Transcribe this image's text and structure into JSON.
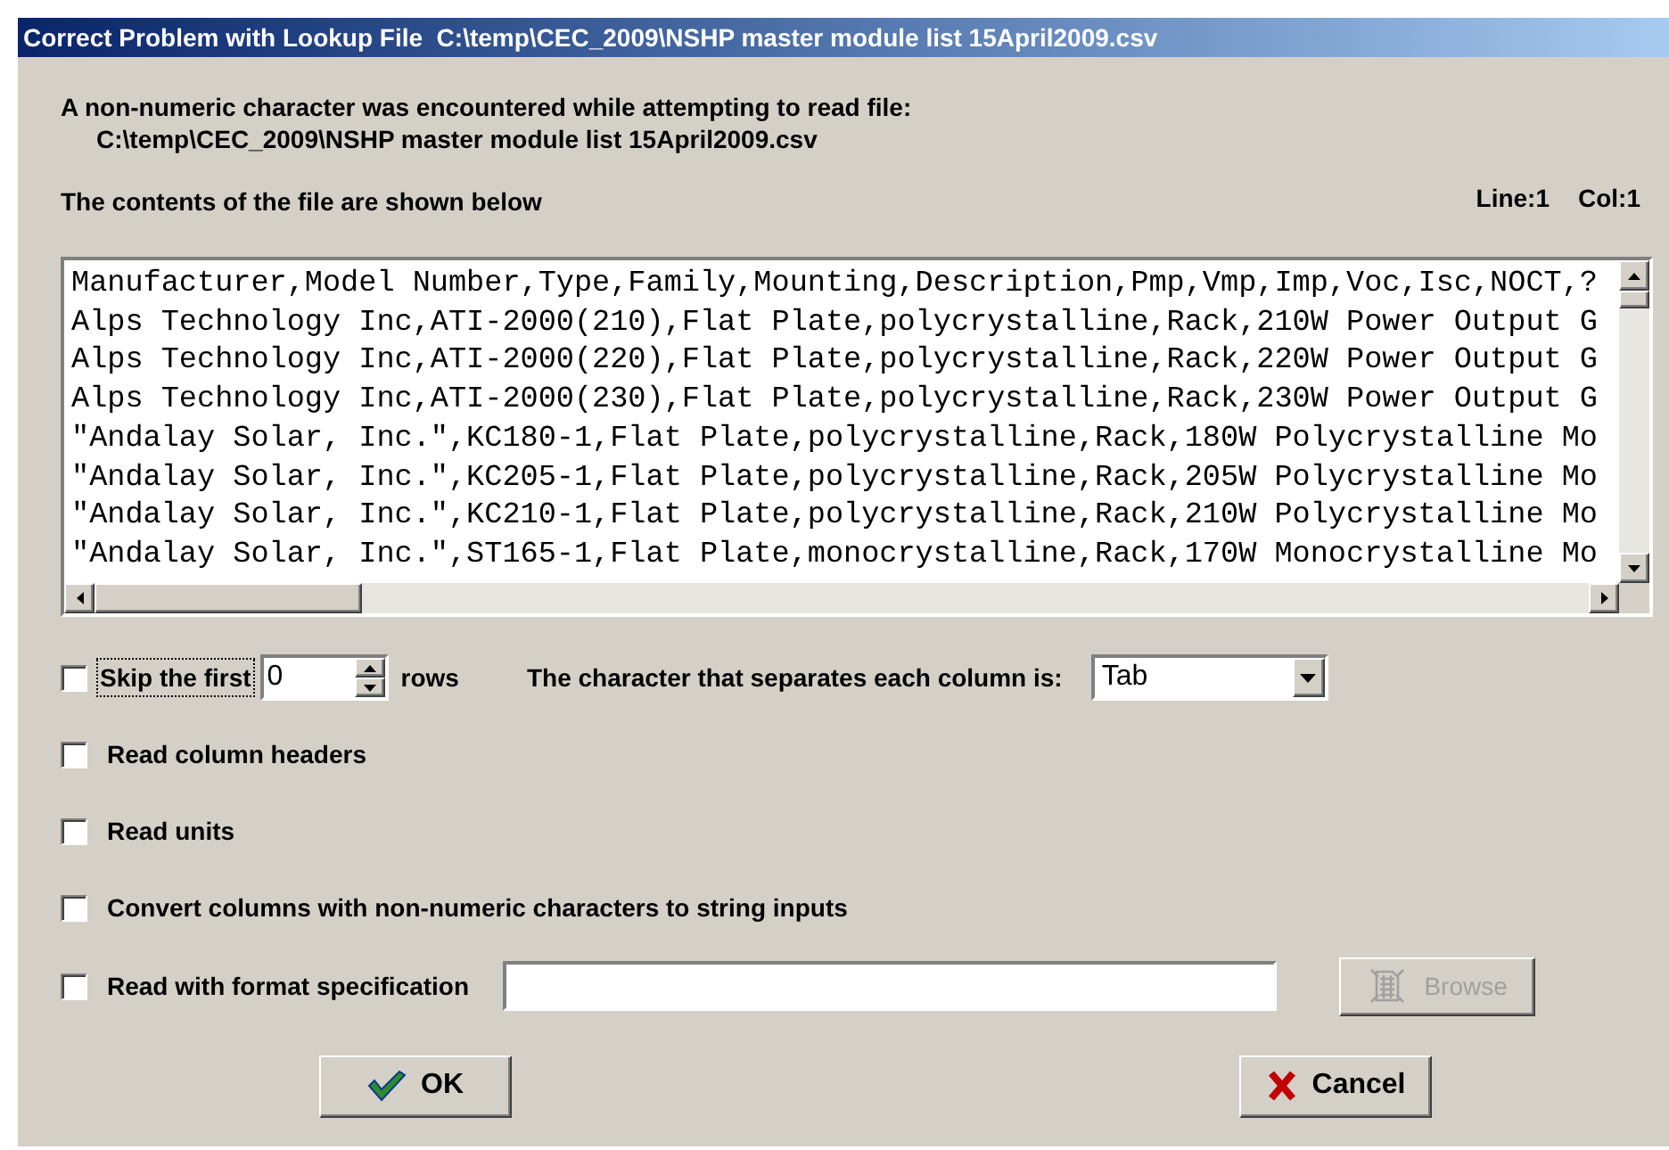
{
  "window": {
    "title": "Correct Problem with Lookup File  C:\\temp\\CEC_2009\\NSHP master module list 15April2009.csv"
  },
  "message": "A non-numeric character was encountered while attempting to read file:",
  "file_path": "C:\\temp\\CEC_2009\\NSHP master module list 15April2009.csv",
  "contents_label": "The contents of the file are shown below",
  "position": {
    "line": "Line:1",
    "col": "Col:1"
  },
  "file_lines": [
    "Manufacturer,Model Number,Type,Family,Mounting,Description,Pmp,Vmp,Imp,Voc,Isc,NOCT,?",
    "Alps Technology Inc,ATI-2000(210),Flat Plate,polycrystalline,Rack,210W Power Output G",
    "Alps Technology Inc,ATI-2000(220),Flat Plate,polycrystalline,Rack,220W Power Output G",
    "Alps Technology Inc,ATI-2000(230),Flat Plate,polycrystalline,Rack,230W Power Output G",
    "\"Andalay Solar, Inc.\",KC180-1,Flat Plate,polycrystalline,Rack,180W Polycrystalline Mo",
    "\"Andalay Solar, Inc.\",KC205-1,Flat Plate,polycrystalline,Rack,205W Polycrystalline Mo",
    "\"Andalay Solar, Inc.\",KC210-1,Flat Plate,polycrystalline,Rack,210W Polycrystalline Mo",
    "\"Andalay Solar, Inc.\",ST165-1,Flat Plate,monocrystalline,Rack,170W Monocrystalline Mo"
  ],
  "skip_row": {
    "label": "Skip the first",
    "checked": false,
    "focused": true,
    "value": "0",
    "suffix": "rows"
  },
  "separator": {
    "label": "The character that separates each column is:",
    "value": "Tab"
  },
  "options": [
    {
      "label": "Read column headers",
      "checked": false
    },
    {
      "label": "Read units",
      "checked": false
    },
    {
      "label": "Convert columns with non-numeric characters to string inputs",
      "checked": false
    }
  ],
  "format_row": {
    "label": "Read with format specification",
    "checked": false
  },
  "browse_button": {
    "label": "Browse",
    "disabled": true
  },
  "ok_button": {
    "label": "OK"
  },
  "cancel_button": {
    "label": "Cancel"
  }
}
